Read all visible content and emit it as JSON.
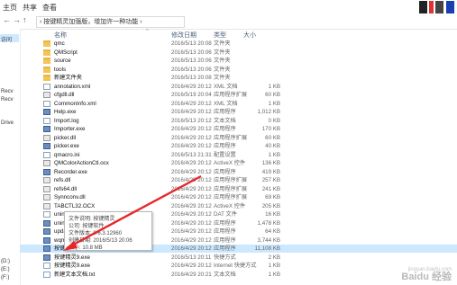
{
  "ribbon": {
    "tabs": [
      "主页",
      "共享",
      "查看"
    ]
  },
  "colors": {
    "accent": "#cce8ff",
    "arrow": "#e8262a"
  },
  "address": {
    "back": "←",
    "forward": "→",
    "up": "↑",
    "path": "› 按键精灵加强版，增加许一种功能 ›"
  },
  "sidebar": {
    "items": [
      "访问",
      "",
      "",
      "",
      "",
      "",
      "",
      "Recv",
      "Recv",
      "",
      "",
      "Drive",
      "",
      "",
      "",
      "",
      "",
      "",
      "",
      "",
      "",
      "",
      "",
      "",
      "",
      "",
      "",
      "",
      "",
      "(D:)",
      "(E:)",
      "(F:)"
    ]
  },
  "header": {
    "name": "名称",
    "date": "修改日期",
    "type": "类型",
    "size": "大小"
  },
  "files": [
    {
      "name": "qmc",
      "date": "2016/5/13 20:08",
      "type": "文件夹",
      "size": "",
      "icon": "folder-icon"
    },
    {
      "name": "QMScript",
      "date": "2016/5/13 20:06",
      "type": "文件夹",
      "size": "",
      "icon": "folder-icon"
    },
    {
      "name": "source",
      "date": "2016/5/13 20:06",
      "type": "文件夹",
      "size": "",
      "icon": "folder-icon"
    },
    {
      "name": "tools",
      "date": "2016/5/13 20:06",
      "type": "文件夹",
      "size": "",
      "icon": "folder-icon"
    },
    {
      "name": "新建文件夹",
      "date": "2016/5/13 20:08",
      "type": "文件夹",
      "size": "",
      "icon": "folder-icon"
    },
    {
      "name": "annotation.xml",
      "date": "2016/4/29 20:12",
      "type": "XML 文档",
      "size": "1 KB",
      "icon": "file-icon"
    },
    {
      "name": "cfgdll.dll",
      "date": "2016/5/19 20:04",
      "type": "应用程序扩展",
      "size": "60 KB",
      "icon": "dll-icon"
    },
    {
      "name": "CommonInfo.xml",
      "date": "2016/4/29 20:12",
      "type": "XML 文档",
      "size": "1 KB",
      "icon": "file-icon"
    },
    {
      "name": "Help.exe",
      "date": "2016/4/29 20:12",
      "type": "应用程序",
      "size": "1,012 KB",
      "icon": "exe-icon"
    },
    {
      "name": "Import.log",
      "date": "2016/5/13 20:12",
      "type": "文本文档",
      "size": "0 KB",
      "icon": "file-icon"
    },
    {
      "name": "Importer.exe",
      "date": "2016/4/29 20:12",
      "type": "应用程序",
      "size": "170 KB",
      "icon": "exe-icon"
    },
    {
      "name": "picker.dll",
      "date": "2016/4/29 20:12",
      "type": "应用程序扩展",
      "size": "60 KB",
      "icon": "dll-icon"
    },
    {
      "name": "picker.exe",
      "date": "2016/4/29 20:12",
      "type": "应用程序",
      "size": "40 KB",
      "icon": "exe-icon"
    },
    {
      "name": "qmacro.ini",
      "date": "2016/5/13 21:31",
      "type": "配置设置",
      "size": "1 KB",
      "icon": "file-icon"
    },
    {
      "name": "QMColorActionCtl.ocx",
      "date": "2016/4/29 20:12",
      "type": "ActiveX 控件",
      "size": "136 KB",
      "icon": "dll-icon"
    },
    {
      "name": "Recorder.exe",
      "date": "2016/4/29 20:12",
      "type": "应用程序",
      "size": "419 KB",
      "icon": "exe-icon"
    },
    {
      "name": "refs.dll",
      "date": "2016/4/29 20:12",
      "type": "应用程序扩展",
      "size": "257 KB",
      "icon": "dll-icon"
    },
    {
      "name": "refs64.dll",
      "date": "2016/4/29 20:12",
      "type": "应用程序扩展",
      "size": "241 KB",
      "icon": "dll-icon"
    },
    {
      "name": "Synnconv.dll",
      "date": "2016/4/29 20:12",
      "type": "应用程序扩展",
      "size": "69 KB",
      "icon": "dll-icon"
    },
    {
      "name": "TABCTL32.OCX",
      "date": "2016/4/29 20:12",
      "type": "ActiveX 控件",
      "size": "205 KB",
      "icon": "dll-icon"
    },
    {
      "name": "unins000.dat",
      "date": "2016/4/29 20:12",
      "type": "DAT 文件",
      "size": "16 KB",
      "icon": "file-icon"
    },
    {
      "name": "unins000.exe",
      "date": "2016/4/29 20:12",
      "type": "应用程序",
      "size": "1,478 KB",
      "icon": "exe-icon"
    },
    {
      "name": "update.exe",
      "date": "2016/4/29 20:12",
      "type": "应用程序",
      "size": "64 KB",
      "icon": "exe-icon"
    },
    {
      "name": "wqm.exe",
      "date": "2016/4/29 20:12",
      "type": "应用程序",
      "size": "3,744 KB",
      "icon": "exe-icon"
    },
    {
      "name": "按键精灵9.exe",
      "date": "2016/4/29 20:12",
      "type": "应用程序",
      "size": "11,108 KB",
      "icon": "exe-icon",
      "selected": true
    },
    {
      "name": "按键精灵9.exe",
      "date": "2016/5/13 20:11",
      "type": "快捷方式",
      "size": "2 KB",
      "icon": "exe-icon"
    },
    {
      "name": "按键精灵9.exe",
      "date": "2016/4/29 20:12",
      "type": "Internet 快捷方式",
      "size": "1 KB",
      "icon": "file-icon"
    },
    {
      "name": "新建文本文档.txt",
      "date": "2016/4/29 20:21",
      "type": "文本文档",
      "size": "1 KB",
      "icon": "file-icon"
    }
  ],
  "tooltip": {
    "desc": "文件说明: 按键精灵",
    "company": "公司: 按键软件",
    "version": "文件版本: 9.6.3.12960",
    "created": "创建日期: 2016/5/13 20:06",
    "size": "大小: 10.8 MB"
  },
  "watermark": {
    "main": "Baidu 经验",
    "sub": "jingyan.baidu.com"
  }
}
